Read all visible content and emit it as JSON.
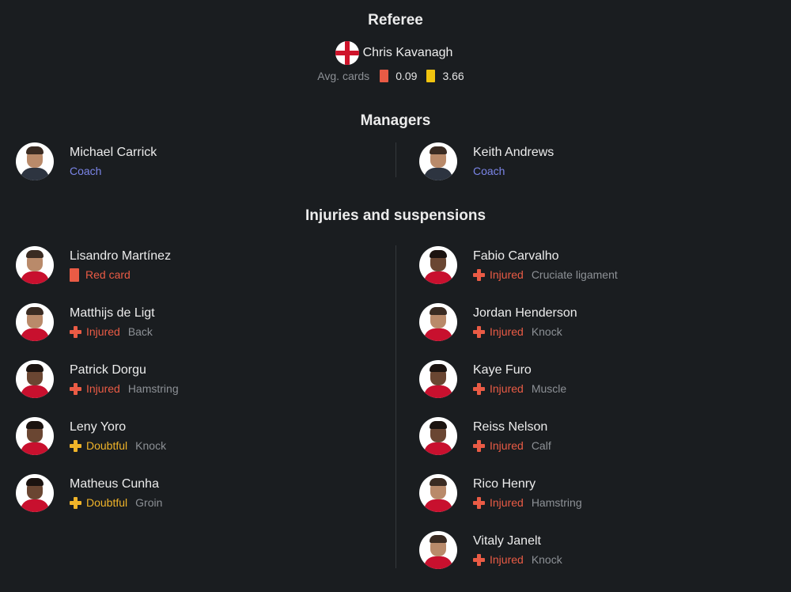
{
  "referee": {
    "title": "Referee",
    "name": "Chris Kavanagh",
    "flag": "england-flag",
    "avg_cards_label": "Avg. cards",
    "red_avg": "0.09",
    "yellow_avg": "3.66"
  },
  "managers": {
    "title": "Managers",
    "home": {
      "name": "Michael Carrick",
      "role": "Coach"
    },
    "away": {
      "name": "Keith Andrews",
      "role": "Coach"
    }
  },
  "injuries": {
    "title": "Injuries and suspensions",
    "home": [
      {
        "name": "Lisandro Martínez",
        "status": "Red card",
        "type": "red-card",
        "reason": ""
      },
      {
        "name": "Matthijs de Ligt",
        "status": "Injured",
        "type": "injured",
        "reason": "Back"
      },
      {
        "name": "Patrick Dorgu",
        "status": "Injured",
        "type": "injured",
        "reason": "Hamstring"
      },
      {
        "name": "Leny Yoro",
        "status": "Doubtful",
        "type": "doubtful",
        "reason": "Knock"
      },
      {
        "name": "Matheus Cunha",
        "status": "Doubtful",
        "type": "doubtful",
        "reason": "Groin"
      }
    ],
    "away": [
      {
        "name": "Fabio Carvalho",
        "status": "Injured",
        "type": "injured",
        "reason": "Cruciate ligament"
      },
      {
        "name": "Jordan Henderson",
        "status": "Injured",
        "type": "injured",
        "reason": "Knock"
      },
      {
        "name": "Kaye Furo",
        "status": "Injured",
        "type": "injured",
        "reason": "Muscle"
      },
      {
        "name": "Reiss Nelson",
        "status": "Injured",
        "type": "injured",
        "reason": "Calf"
      },
      {
        "name": "Rico Henry",
        "status": "Injured",
        "type": "injured",
        "reason": "Hamstring"
      },
      {
        "name": "Vitaly Janelt",
        "status": "Injured",
        "type": "injured",
        "reason": "Knock"
      }
    ]
  },
  "colors": {
    "background": "#1a1d20",
    "red_status": "#ea5b45",
    "doubtful": "#f0b429",
    "coach_label": "#7b85e8",
    "muted": "#8d9196"
  }
}
